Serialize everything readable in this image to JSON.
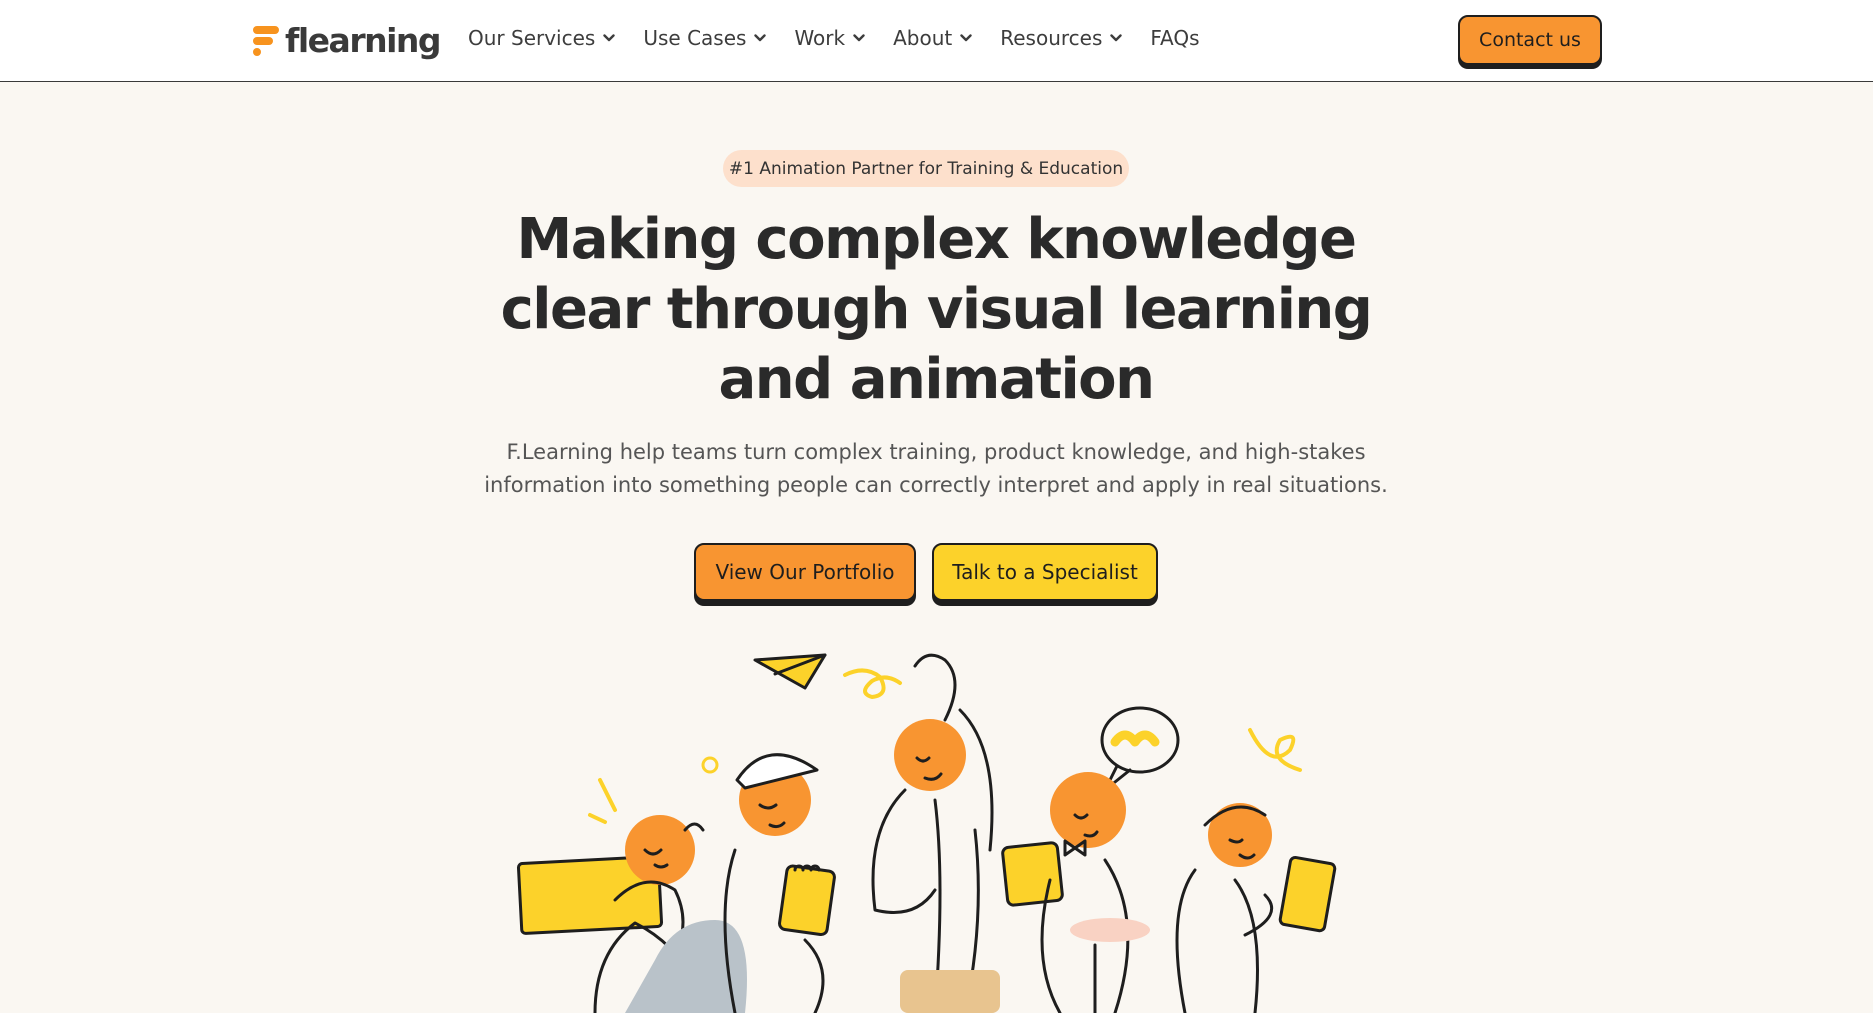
{
  "header": {
    "logo_text": "flearning",
    "nav": [
      {
        "label": "Our Services",
        "has_dropdown": true
      },
      {
        "label": "Use Cases",
        "has_dropdown": true
      },
      {
        "label": "Work",
        "has_dropdown": true
      },
      {
        "label": "About",
        "has_dropdown": true
      },
      {
        "label": "Resources",
        "has_dropdown": true
      },
      {
        "label": "FAQs",
        "has_dropdown": false
      }
    ],
    "contact_label": "Contact us"
  },
  "hero": {
    "badge": "#1 Animation Partner for Training & Education",
    "headline_lines": [
      "Making complex knowledge",
      "clear through visual learning",
      "and animation"
    ],
    "subtext_lines": [
      "F.Learning help teams turn complex training, product knowledge, and high-stakes",
      "information into something people can correctly interpret and apply in real situations."
    ],
    "primary_cta": "View Our Portfolio",
    "secondary_cta": "Talk to a Specialist"
  },
  "colors": {
    "accent_orange": "#f89531",
    "accent_yellow": "#fcd22a",
    "badge_bg": "#fde0cc",
    "page_bg": "#faf7f2"
  }
}
